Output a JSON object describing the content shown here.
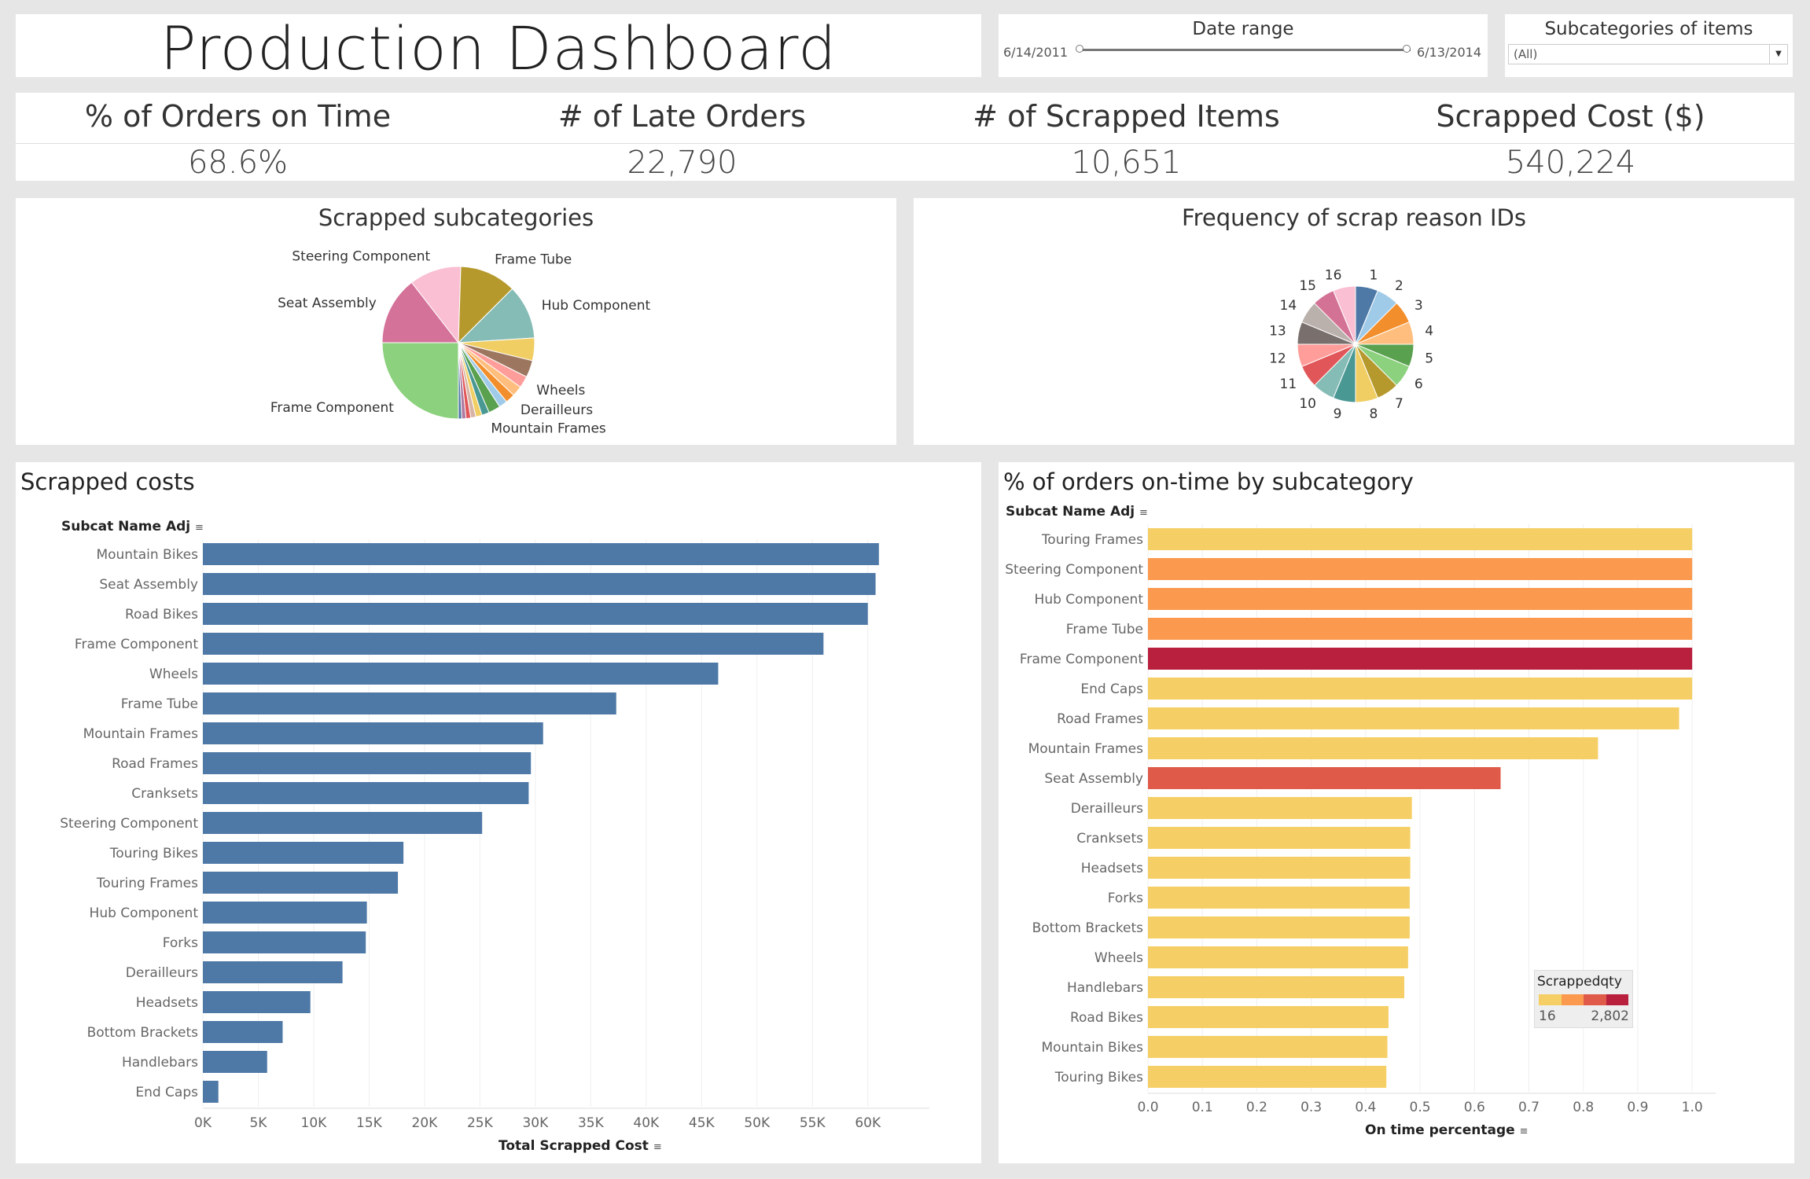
{
  "dashboard": {
    "title": "Production Dashboard"
  },
  "filters": {
    "date_range": {
      "label": "Date range",
      "start": "6/14/2011",
      "end": "6/13/2014"
    },
    "subcategory": {
      "label": "Subcategories of items",
      "selected": "(All)"
    }
  },
  "kpis": [
    {
      "label": "% of Orders on Time",
      "value": "68.6%"
    },
    {
      "label": "# of Late Orders",
      "value": "22,790"
    },
    {
      "label": "# of Scrapped Items",
      "value": "10,651"
    },
    {
      "label": "Scrapped Cost ($)",
      "value": "540,224"
    }
  ],
  "chart_data": [
    {
      "type": "pie",
      "title": "Scrapped subcategories",
      "slices": [
        {
          "label": "Frame Component",
          "value": 25.0,
          "color": "#8cd17d"
        },
        {
          "label": "Seat Assembly",
          "value": 14.5,
          "color": "#d4729a"
        },
        {
          "label": "Steering Component",
          "value": 11.0,
          "color": "#fabfd2"
        },
        {
          "label": "Frame Tube",
          "value": 12.0,
          "color": "#b6992d"
        },
        {
          "label": "Hub Component",
          "value": 11.5,
          "color": "#86bcb6"
        },
        {
          "label": "",
          "value": 4.8,
          "color": "#f1ce63"
        },
        {
          "label": "",
          "value": 3.6,
          "color": "#9d7660"
        },
        {
          "label": "Wheels",
          "value": 2.5,
          "color": "#ff9d9a"
        },
        {
          "label": "",
          "value": 2.2,
          "color": "#ffbe7d"
        },
        {
          "label": "Derailleurs",
          "value": 2.0,
          "color": "#f28e2b"
        },
        {
          "label": "",
          "value": 1.8,
          "color": "#a0cbe8"
        },
        {
          "label": "",
          "value": 2.5,
          "color": "#59a14f"
        },
        {
          "label": "Mountain Frames",
          "value": 1.6,
          "color": "#499894"
        },
        {
          "label": "",
          "value": 1.3,
          "color": "#f1ce63"
        },
        {
          "label": "",
          "value": 1.1,
          "color": "#d7b5a6"
        },
        {
          "label": "",
          "value": 1.0,
          "color": "#e15759"
        },
        {
          "label": "",
          "value": 0.9,
          "color": "#b07aa1"
        },
        {
          "label": "",
          "value": 0.7,
          "color": "#4e79a7"
        }
      ]
    },
    {
      "type": "pie",
      "title": "Frequency of scrap reason IDs",
      "slices": [
        {
          "label": "1",
          "value": 1,
          "color": "#4e79a7"
        },
        {
          "label": "2",
          "value": 1,
          "color": "#a0cbe8"
        },
        {
          "label": "3",
          "value": 1,
          "color": "#f28e2b"
        },
        {
          "label": "4",
          "value": 1,
          "color": "#ffbe7d"
        },
        {
          "label": "5",
          "value": 1,
          "color": "#59a14f"
        },
        {
          "label": "6",
          "value": 1,
          "color": "#8cd17d"
        },
        {
          "label": "7",
          "value": 1,
          "color": "#b6992d"
        },
        {
          "label": "8",
          "value": 1,
          "color": "#f1ce63"
        },
        {
          "label": "9",
          "value": 1,
          "color": "#499894"
        },
        {
          "label": "10",
          "value": 1,
          "color": "#86bcb6"
        },
        {
          "label": "11",
          "value": 1,
          "color": "#e15759"
        },
        {
          "label": "12",
          "value": 1,
          "color": "#ff9d9a"
        },
        {
          "label": "13",
          "value": 1,
          "color": "#79706e"
        },
        {
          "label": "14",
          "value": 1,
          "color": "#bab0ac"
        },
        {
          "label": "15",
          "value": 1,
          "color": "#d37295"
        },
        {
          "label": "16",
          "value": 1,
          "color": "#fabfd2"
        }
      ]
    },
    {
      "type": "bar",
      "orientation": "horizontal",
      "title": "Scrapped costs",
      "row_header": "Subcat Name Adj",
      "xlabel": "Total Scrapped Cost",
      "xlim": [
        0,
        63000
      ],
      "xticks": [
        0,
        5000,
        10000,
        15000,
        20000,
        25000,
        30000,
        35000,
        40000,
        45000,
        50000,
        55000,
        60000
      ],
      "xtick_labels": [
        "0K",
        "5K",
        "10K",
        "15K",
        "20K",
        "25K",
        "30K",
        "35K",
        "40K",
        "45K",
        "50K",
        "55K",
        "60K"
      ],
      "bar_color": "#4e79a7",
      "categories": [
        "Mountain Bikes",
        "Seat Assembly",
        "Road Bikes",
        "Frame Component",
        "Wheels",
        "Frame Tube",
        "Mountain Frames",
        "Road Frames",
        "Cranksets",
        "Steering Component",
        "Touring Bikes",
        "Touring Frames",
        "Hub Component",
        "Forks",
        "Derailleurs",
        "Headsets",
        "Bottom Brackets",
        "Handlebars",
        "End Caps"
      ],
      "values": [
        61000,
        60700,
        60000,
        56000,
        46500,
        37300,
        30700,
        29600,
        29400,
        25200,
        18100,
        17600,
        14800,
        14700,
        12600,
        9700,
        7200,
        5800,
        1400
      ]
    },
    {
      "type": "bar",
      "orientation": "horizontal",
      "title": "% of  orders on-time by subcategory",
      "row_header": "Subcat Name Adj",
      "xlabel": "On time percentage",
      "xlim": [
        0,
        1.02
      ],
      "xticks": [
        0.0,
        0.1,
        0.2,
        0.3,
        0.4,
        0.5,
        0.6,
        0.7,
        0.8,
        0.9,
        1.0
      ],
      "xtick_labels": [
        "0.0",
        "0.1",
        "0.2",
        "0.3",
        "0.4",
        "0.5",
        "0.6",
        "0.7",
        "0.8",
        "0.9",
        "1.0"
      ],
      "categories": [
        "Touring Frames",
        "Steering Component",
        "Hub Component",
        "Frame Tube",
        "Frame Component",
        "End Caps",
        "Road Frames",
        "Mountain Frames",
        "Seat Assembly",
        "Derailleurs",
        "Cranksets",
        "Headsets",
        "Forks",
        "Bottom Brackets",
        "Wheels",
        "Handlebars",
        "Road Bikes",
        "Mountain Bikes",
        "Touring Bikes"
      ],
      "values": [
        1.0,
        1.0,
        1.0,
        1.0,
        1.0,
        1.0,
        0.976,
        0.827,
        0.648,
        0.485,
        0.482,
        0.482,
        0.481,
        0.481,
        0.478,
        0.471,
        0.442,
        0.44,
        0.438
      ],
      "colors": [
        "#f5cf66",
        "#fb9a4f",
        "#fb9a4f",
        "#fb9a4f",
        "#b8203e",
        "#f5cf66",
        "#f5cf66",
        "#f5cf66",
        "#e05a4a",
        "#f5cf66",
        "#f5cf66",
        "#f5cf66",
        "#f5cf66",
        "#f5cf66",
        "#f5cf66",
        "#f5cf66",
        "#f5cf66",
        "#f5cf66",
        "#f5cf66"
      ],
      "legend": {
        "title": "Scrappedqty",
        "min": "16",
        "max": "2,802",
        "ramp": [
          "#f5cf66",
          "#fb9a4f",
          "#e05a4a",
          "#b8203e"
        ]
      }
    }
  ]
}
